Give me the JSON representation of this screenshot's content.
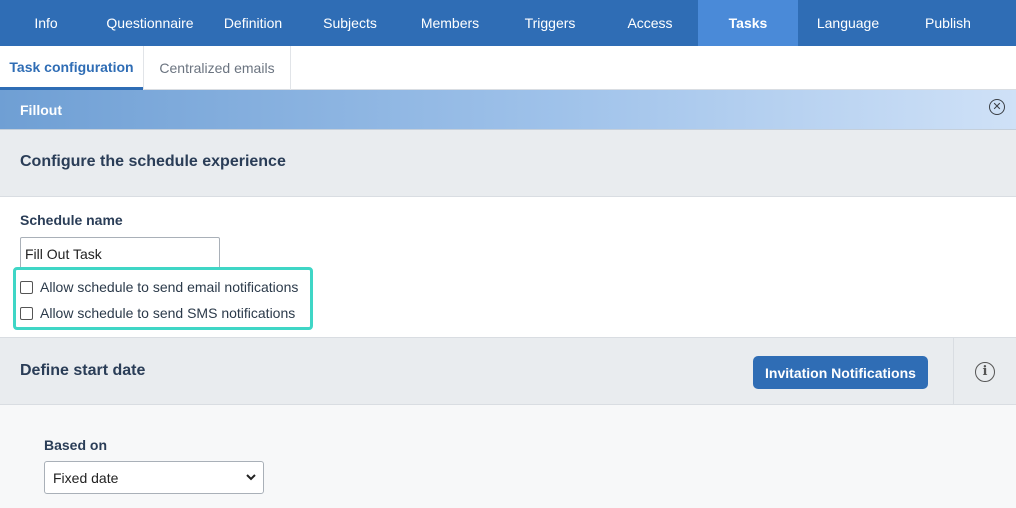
{
  "nav": {
    "items": [
      {
        "label": "Info",
        "active": false
      },
      {
        "label": "Questionnaire",
        "active": false
      },
      {
        "label": "Definition",
        "active": false
      },
      {
        "label": "Subjects",
        "active": false
      },
      {
        "label": "Members",
        "active": false
      },
      {
        "label": "Triggers",
        "active": false
      },
      {
        "label": "Access",
        "active": false
      },
      {
        "label": "Tasks",
        "active": true
      },
      {
        "label": "Language",
        "active": false
      },
      {
        "label": "Publish",
        "active": false
      }
    ]
  },
  "subtabs": {
    "active_label": "Task configuration",
    "second_label": "Centralized emails"
  },
  "panel": {
    "title": "Fillout",
    "close_icon": "close-circle-icon"
  },
  "schedule_section": {
    "title": "Configure the schedule experience",
    "name_label": "Schedule name",
    "name_value": "Fill Out Task",
    "email_checkbox_label": "Allow schedule to send email notifications",
    "email_checked": false,
    "sms_checkbox_label": "Allow schedule to send SMS notifications",
    "sms_checked": false
  },
  "start_section": {
    "title": "Define start date",
    "button_label": "Invitation Notifications",
    "info_icon": "info-icon",
    "based_on_label": "Based on",
    "based_on_value": "Fixed date"
  },
  "colors": {
    "nav_bg": "#2f6db5",
    "nav_active": "#4a8ad8",
    "highlight": "#3fd6c6",
    "button_bg": "#2f6db5"
  }
}
